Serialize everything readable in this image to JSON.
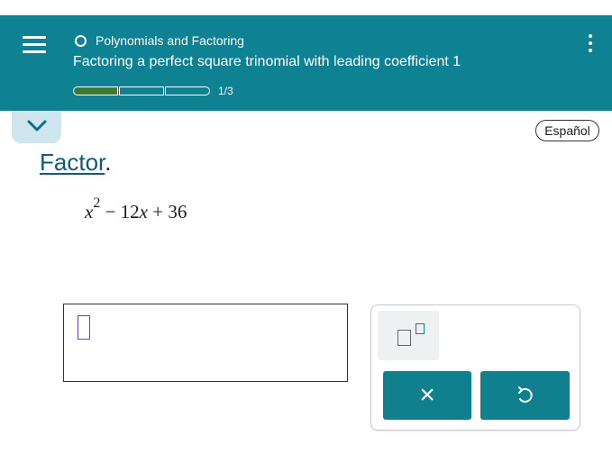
{
  "header": {
    "topic": "Polynomials and Factoring",
    "lesson_title": "Factoring a perfect square trinomial with leading coefficient 1",
    "progress": {
      "completed": 1,
      "total": 3,
      "label": "1/3"
    },
    "colors": {
      "banner": "#0e8193",
      "progress_fill": "#3d7a3a"
    }
  },
  "language_button": {
    "label": "Español"
  },
  "problem": {
    "instruction_link": "Factor",
    "instruction_punct": ".",
    "expression": {
      "base": "x",
      "exponent": "2",
      "op1": "−",
      "coef": "12",
      "var": "x",
      "op2": "+",
      "constant": "36"
    }
  },
  "answer": {
    "value": ""
  },
  "palette": {
    "clear_label": "×",
    "icons": {
      "exponent": "superscript-template-icon",
      "clear": "close-icon",
      "undo": "undo-icon"
    },
    "colors": {
      "buttons": "#10808f",
      "cursor": "#5b45e6"
    }
  },
  "icons": {
    "menu": "hamburger-menu-icon",
    "topic": "circle-outline-icon",
    "more": "vertical-ellipsis-icon",
    "collapse": "chevron-down-icon"
  }
}
